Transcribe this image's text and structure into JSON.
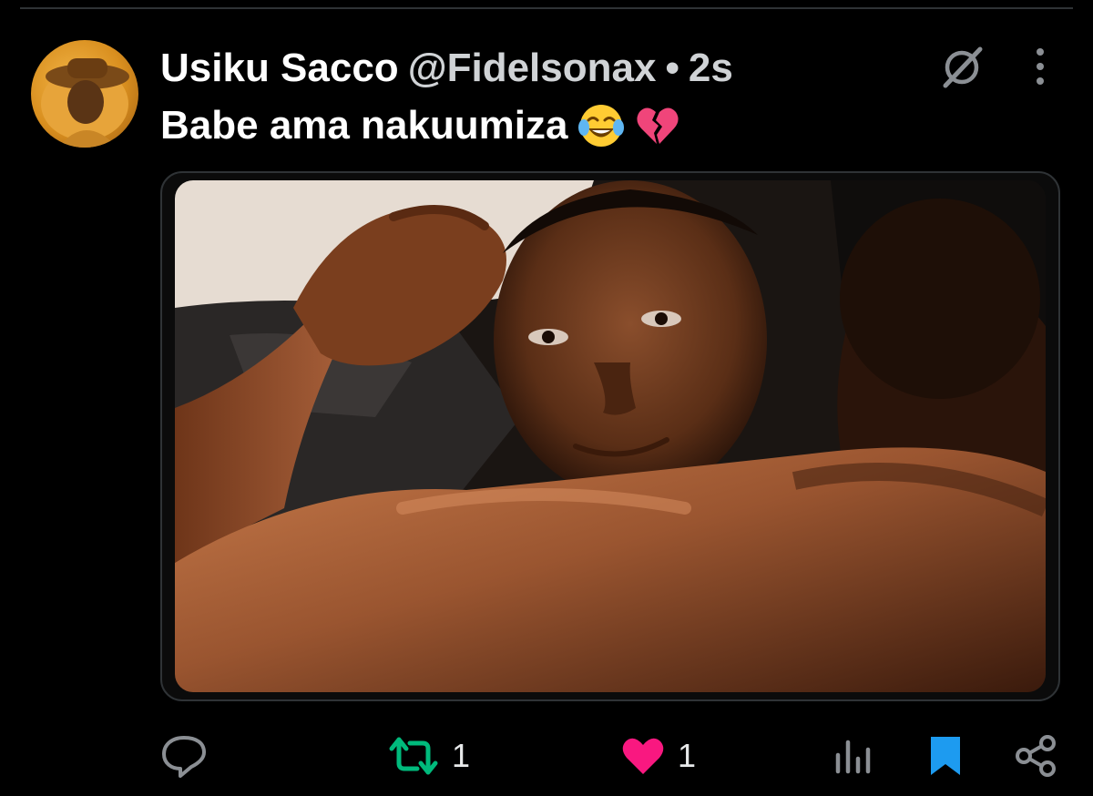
{
  "post": {
    "display_name": "Usiku Sacco",
    "handle": "@Fidelsonax",
    "separator": "•",
    "time": "2s",
    "text": "Babe ama nakuumiza",
    "emojis": [
      "face-with-tears-of-joy",
      "broken-heart"
    ]
  },
  "actions": {
    "reply": {
      "icon": "reply-icon",
      "count": ""
    },
    "repost": {
      "icon": "repost-icon",
      "count": "1",
      "active": true,
      "color": "#00ba7c"
    },
    "like": {
      "icon": "heart-icon",
      "count": "1",
      "active": true,
      "color": "#f91880"
    },
    "views": {
      "icon": "views-icon"
    },
    "bookmark": {
      "icon": "bookmark-icon",
      "active": true,
      "color": "#1d9bf0"
    },
    "share": {
      "icon": "share-icon"
    }
  },
  "colors": {
    "background": "#000000",
    "text": "#e7e9ea",
    "secondary_text": "#d0d3d6",
    "border": "#2f3336"
  }
}
